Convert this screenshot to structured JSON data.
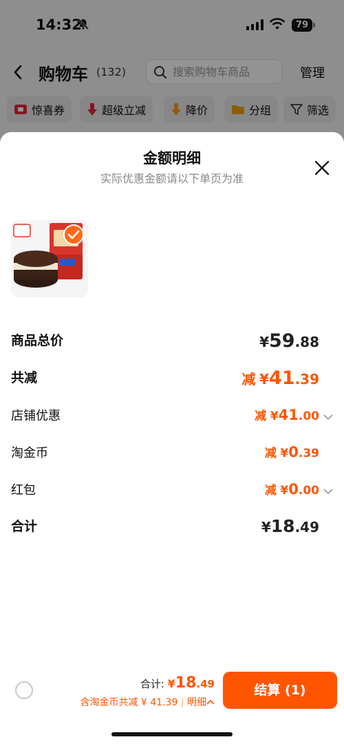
{
  "status_bar": {
    "time": "14:32",
    "battery": "79"
  },
  "nav": {
    "title": "购物车",
    "count": "(132)",
    "search_placeholder": "搜索购物车商品",
    "manage": "管理"
  },
  "filters": [
    {
      "label": "惊喜券",
      "icon": "coupon-icon"
    },
    {
      "label": "超级立减",
      "icon": "arrow-down-red-icon"
    },
    {
      "label": "降价",
      "icon": "arrow-down-orange-icon"
    },
    {
      "label": "分组",
      "icon": "folder-icon"
    },
    {
      "label": "筛选",
      "icon": "filter-icon"
    }
  ],
  "sheet": {
    "title": "金额明细",
    "subtitle": "实际优惠金额请以下单页为准",
    "rows": {
      "total_price": {
        "label": "商品总价",
        "currency": "¥",
        "int": "59",
        "dec": ".88"
      },
      "total_reduction": {
        "label": "共减",
        "prefix": "减",
        "currency": "¥",
        "int": "41",
        "dec": ".39"
      },
      "store_discount": {
        "label": "店铺优惠",
        "prefix": "减",
        "currency": "¥",
        "int": "41",
        "dec": ".00"
      },
      "taojin_coin": {
        "label": "淘金币",
        "prefix": "减",
        "currency": "¥",
        "int": "0",
        "dec": ".39"
      },
      "red_packet": {
        "label": "红包",
        "prefix": "减",
        "currency": "¥",
        "int": "0",
        "dec": ".00"
      },
      "sum": {
        "label": "合计",
        "currency": "¥",
        "int": "18",
        "dec": ".49"
      }
    }
  },
  "footer": {
    "total_label": "合计:",
    "currency": "¥",
    "total_int": "18",
    "total_dec": ".49",
    "discount_text": "含淘金币共减 ¥ 41.39",
    "detail_label": "明细",
    "checkout": "结算 (1)"
  },
  "colors": {
    "accent": "#ff5500",
    "overlay": "rgba(0,0,0,0.42)"
  }
}
